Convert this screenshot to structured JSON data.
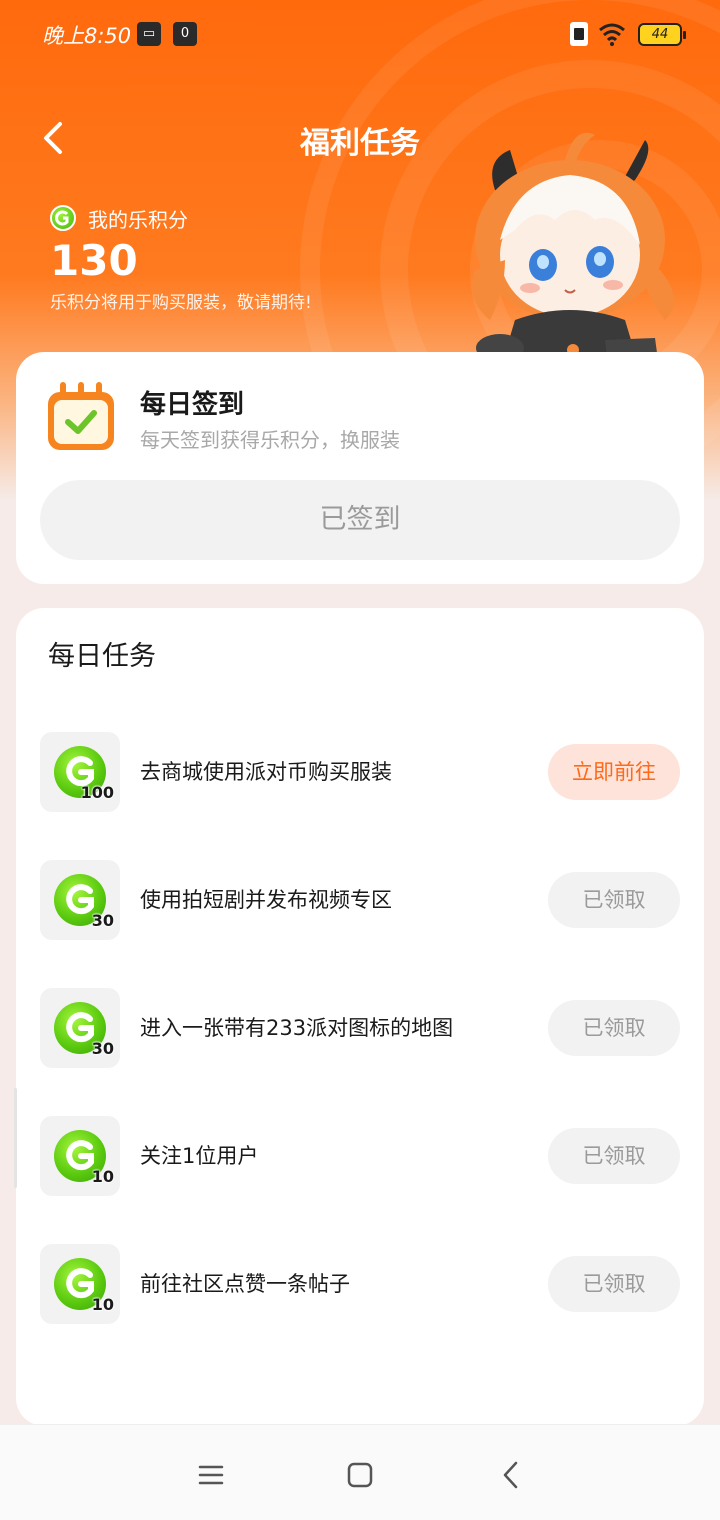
{
  "status_bar": {
    "time": "晚上8:50",
    "icon_video": "▭",
    "icon_o": "0",
    "battery": "44"
  },
  "header": {
    "title": "福利任务",
    "points_label": "我的乐积分",
    "points_value": "130",
    "points_note": "乐积分将用于购买服装，敬请期待!"
  },
  "signin": {
    "title": "每日签到",
    "subtitle": "每天签到获得乐积分，换服装",
    "button_label": "已签到"
  },
  "tasks": {
    "title": "每日任务",
    "items": [
      {
        "reward": "100",
        "text": "去商城使用派对币购买服装",
        "button": "立即前往",
        "state": "go"
      },
      {
        "reward": "30",
        "text": "使用拍短剧并发布视频专区",
        "button": "已领取",
        "state": "done"
      },
      {
        "reward": "30",
        "text": "进入一张带有233派对图标的地图",
        "button": "已领取",
        "state": "done"
      },
      {
        "reward": "10",
        "text": "关注1位用户",
        "button": "已领取",
        "state": "done"
      },
      {
        "reward": "10",
        "text": "前往社区点赞一条帖子",
        "button": "已领取",
        "state": "done"
      }
    ]
  },
  "colors": {
    "accent": "#ff6a0d",
    "coin_green": "#5ccb10",
    "go_bg": "#fde3da",
    "go_text": "#ff6a1a"
  }
}
